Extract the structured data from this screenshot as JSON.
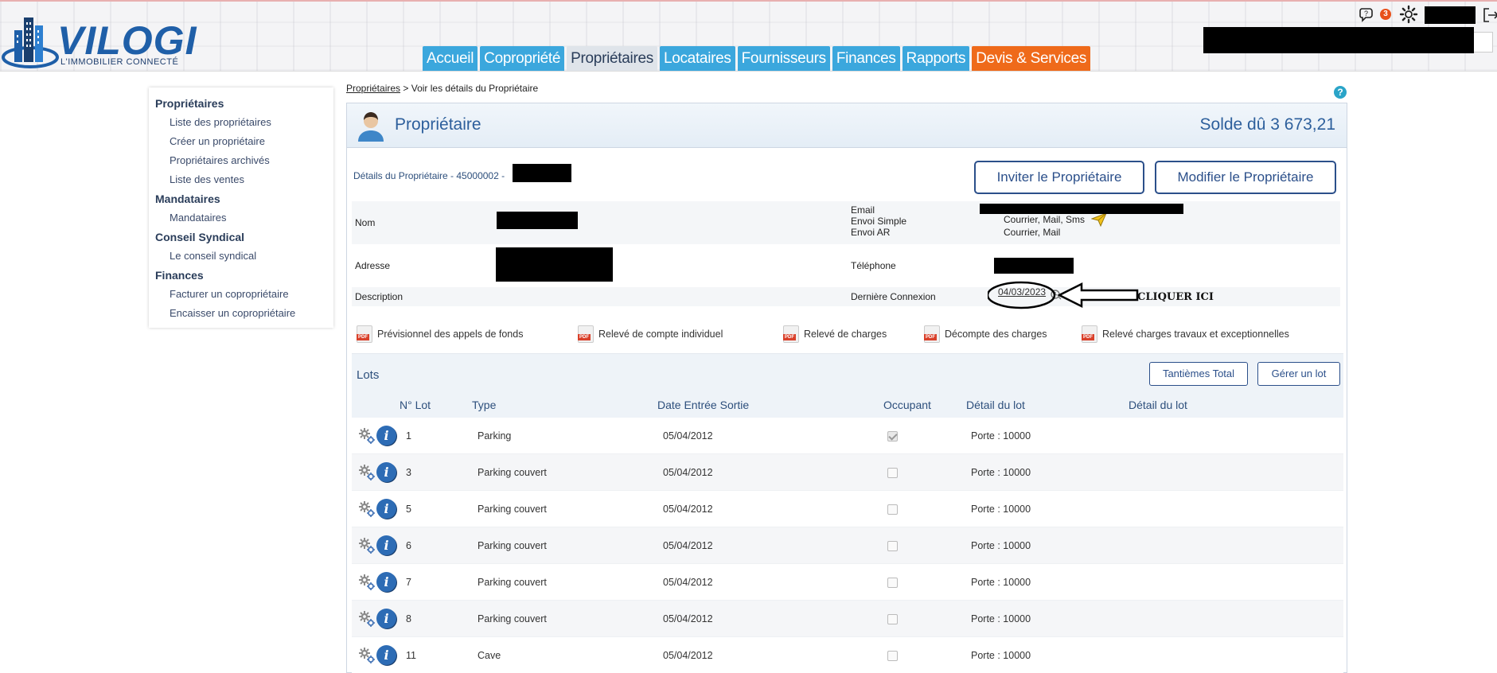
{
  "brand": {
    "name": "VILOGI",
    "tagline": "L'IMMOBILIER CONNECTÉ",
    "primary": "#1f5fa8",
    "nav_blue": "#3ba7dd",
    "nav_orange": "#ef6a1a"
  },
  "header": {
    "notification_count": "3",
    "nav": [
      {
        "label": "Accueil"
      },
      {
        "label": "Copropriété"
      },
      {
        "label": "Propriétaires",
        "active": true
      },
      {
        "label": "Locataires"
      },
      {
        "label": "Fournisseurs"
      },
      {
        "label": "Finances"
      },
      {
        "label": "Rapports"
      },
      {
        "label": "Devis & Services"
      }
    ]
  },
  "sidebar": {
    "sections": [
      {
        "title": "Propriétaires",
        "items": [
          "Liste des propriétaires",
          "Créer un propriétaire",
          "Propriétaires archivés",
          "Liste des ventes"
        ]
      },
      {
        "title": "Mandataires",
        "items": [
          "Mandataires"
        ]
      },
      {
        "title": "Conseil Syndical",
        "items": [
          "Le conseil syndical"
        ]
      },
      {
        "title": "Finances",
        "items": [
          "Facturer un copropriétaire",
          "Encaisser un copropriétaire"
        ]
      }
    ]
  },
  "breadcrumb": {
    "link": "Propriétaires",
    "separator": ">",
    "current": "Voir les détails du Propriétaire"
  },
  "panel": {
    "title": "Propriétaire",
    "solde": "Solde dû 3 673,21"
  },
  "details": {
    "label": "Détails du Propriétaire - 45000002 -",
    "invite_button": "Inviter le Propriétaire",
    "modify_button": "Modifier le Propriétaire",
    "nom_label": "Nom",
    "adresse_label": "Adresse",
    "description_label": "Description",
    "email_label": "Email",
    "envoi_simple_label": "Envoi Simple",
    "envoi_ar_label": "Envoi AR",
    "envoi_simple_value": "Courrier, Mail, Sms",
    "envoi_ar_value": "Courrier, Mail",
    "telephone_label": "Téléphone",
    "derniere_connexion_label": "Dernière Connexion",
    "derniere_connexion_value": "04/03/2023",
    "annotation": "CLIQUER ICI"
  },
  "pdfs": [
    "Prévisionnel des appels de fonds",
    "Relevé de compte individuel",
    "Relevé de charges",
    "Décompte des charges",
    "Relevé charges travaux et exceptionnelles"
  ],
  "lots": {
    "title": "Lots",
    "tantiemes_button": "Tantièmes Total",
    "gerer_button": "Gérer un lot",
    "columns": [
      "N° Lot",
      "Type",
      "Date Entrée Sortie",
      "Occupant",
      "Détail du lot",
      "Détail du lot"
    ],
    "rows": [
      {
        "num": "1",
        "type": "Parking",
        "date": "05/04/2012",
        "occupant": true,
        "detail": "Porte : 10000"
      },
      {
        "num": "3",
        "type": "Parking couvert",
        "date": "05/04/2012",
        "occupant": false,
        "detail": "Porte : 10000"
      },
      {
        "num": "5",
        "type": "Parking couvert",
        "date": "05/04/2012",
        "occupant": false,
        "detail": "Porte : 10000"
      },
      {
        "num": "6",
        "type": "Parking couvert",
        "date": "05/04/2012",
        "occupant": false,
        "detail": "Porte : 10000"
      },
      {
        "num": "7",
        "type": "Parking couvert",
        "date": "05/04/2012",
        "occupant": false,
        "detail": "Porte : 10000"
      },
      {
        "num": "8",
        "type": "Parking couvert",
        "date": "05/04/2012",
        "occupant": false,
        "detail": "Porte : 10000"
      },
      {
        "num": "11",
        "type": "Cave",
        "date": "05/04/2012",
        "occupant": false,
        "detail": "Porte : 10000"
      }
    ]
  }
}
